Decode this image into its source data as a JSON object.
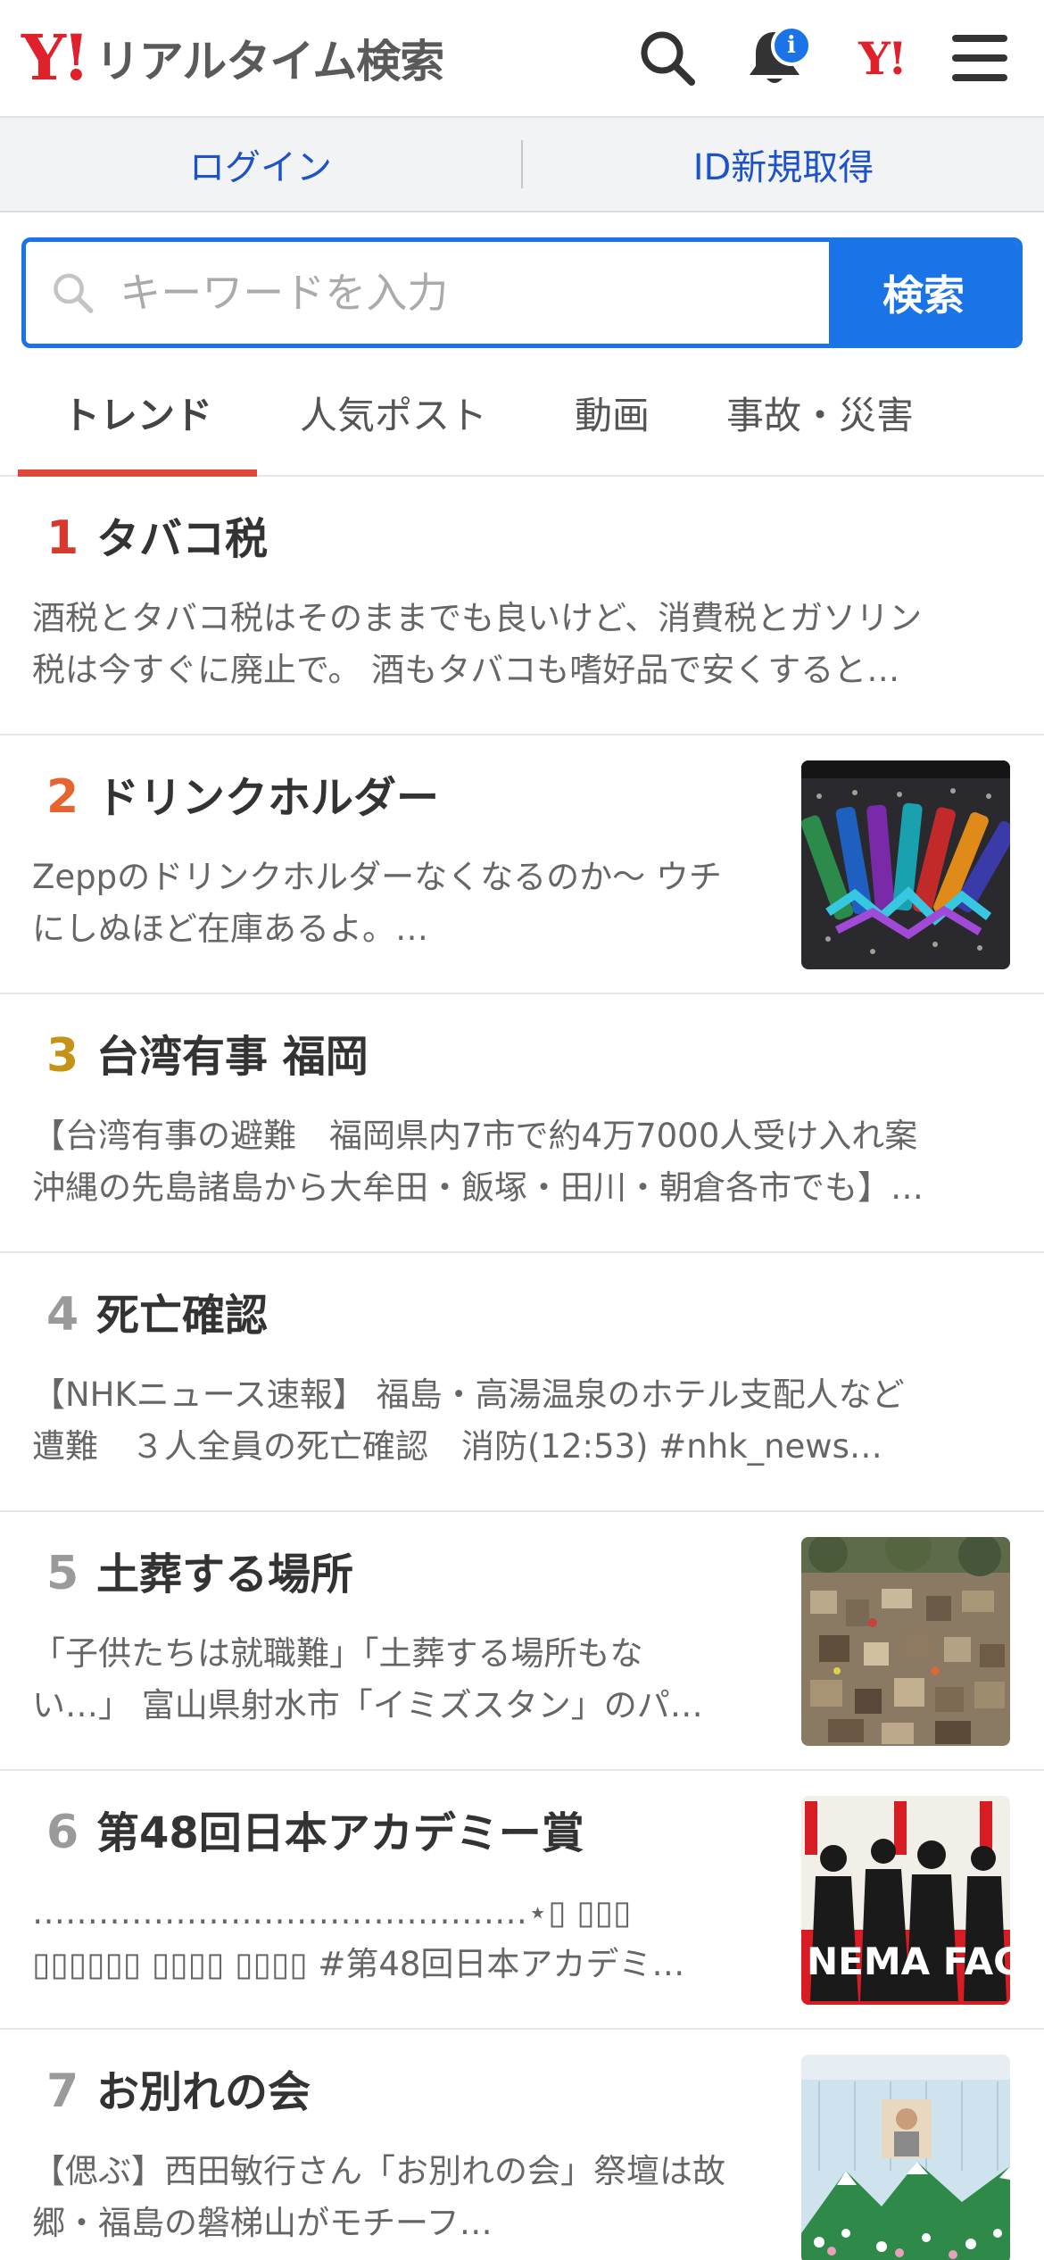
{
  "header": {
    "logo": "Y!",
    "title": "リアルタイム検索",
    "notification_badge": "i",
    "yahoo_small": "Y!",
    "icons": [
      "search-icon",
      "bell-icon",
      "yahoo-logo-icon",
      "menu-icon"
    ]
  },
  "auth": {
    "login": "ログイン",
    "register": "ID新規取得"
  },
  "search": {
    "placeholder": "キーワードを入力",
    "button": "検索"
  },
  "tabs": [
    {
      "label": "トレンド",
      "active": true
    },
    {
      "label": "人気ポスト",
      "active": false
    },
    {
      "label": "動画",
      "active": false
    },
    {
      "label": "事故・災害",
      "active": false
    }
  ],
  "colors": {
    "accent": "#1a74e8",
    "tab_underline": "#e0463a",
    "rank1": "#d9382c",
    "rank2": "#e8642f",
    "rank3": "#c49318",
    "rank_other": "#9a9a9a"
  },
  "trends": [
    {
      "rank": "1",
      "title": "タバコ税",
      "line1": "酒税とタバコ税はそのままでも良いけど、消費税とガソリン",
      "line2": "税は今すぐに廃止で。 酒もタバコも嗜好品で安くすると…"
    },
    {
      "rank": "2",
      "title": "ドリンクホルダー",
      "line1": "Zeppのドリンクホルダーなくなるのか〜 ウチ",
      "line2": "にしぬほど在庫あるよ。…"
    },
    {
      "rank": "3",
      "title": "台湾有事 福岡",
      "line1": "【台湾有事の避難　福岡県内7市で約4万7000人受け入れ案",
      "line2": "沖縄の先島諸島から大牟田・飯塚・田川・朝倉各市でも】…"
    },
    {
      "rank": "4",
      "title": "死亡確認",
      "line1": "【NHKニュース速報】 福島・高湯温泉のホテル支配人など",
      "line2": "遭難　３人全員の死亡確認　消防(12:53) #nhk_news…"
    },
    {
      "rank": "5",
      "title": "土葬する場所",
      "line1": "「子供たちは就職難」「土葬する場所もな",
      "line2": "い…」 富山県射水市「イミズスタン」のパ…"
    },
    {
      "rank": "6",
      "title": "第48回日本アカデミー賞",
      "line1": "………………………………………⋆▯ ▯▯▯",
      "line2": "▯▯▯▯▯▯ ▯▯▯▯ ▯▯▯▯ #第48回日本アカデミ…"
    },
    {
      "rank": "7",
      "title": "お別れの会",
      "line1": "【偲ぶ】西田敏行さん「お別れの会」祭壇は故",
      "line2": "郷・福島の磐梯山がモチーフ…"
    }
  ],
  "thumb_text": {
    "cinema": "NEMA FACE"
  }
}
